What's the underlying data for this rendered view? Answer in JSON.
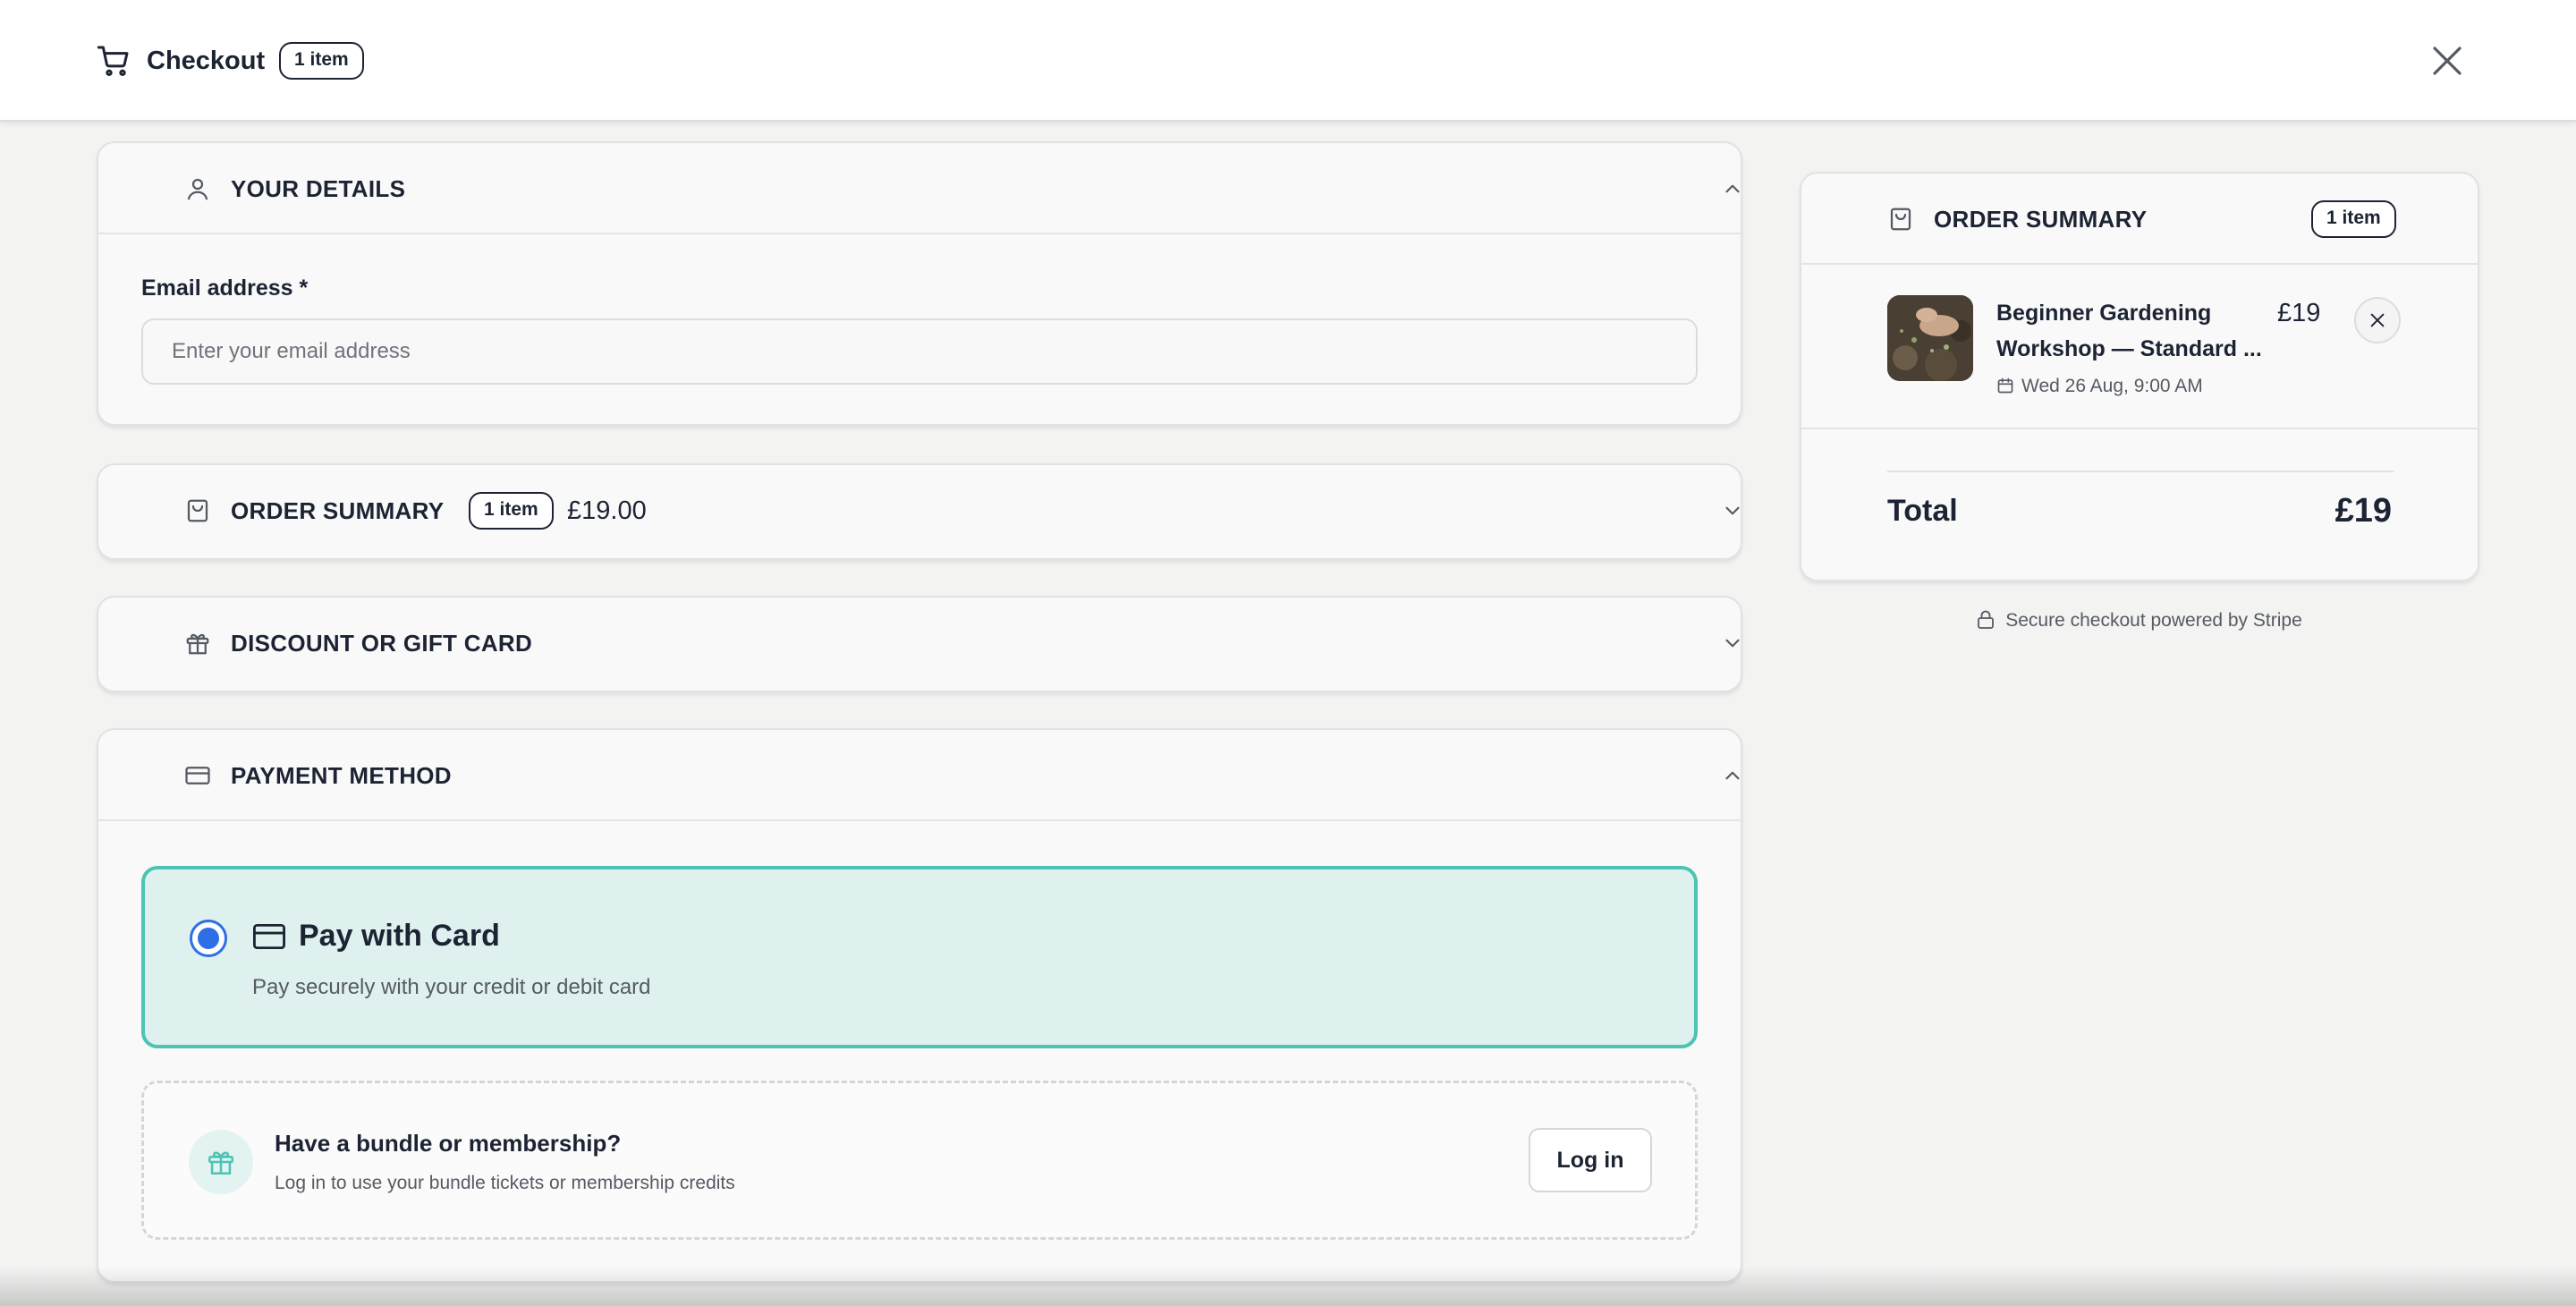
{
  "header": {
    "title": "Checkout",
    "item_count": "1 item"
  },
  "details": {
    "title": "YOUR DETAILS",
    "email_label": "Email address *",
    "email_placeholder": "Enter your email address",
    "email_value": ""
  },
  "summary_section": {
    "title": "ORDER SUMMARY",
    "item_count": "1 item",
    "price": "£19.00"
  },
  "discount": {
    "title": "DISCOUNT OR GIFT CARD"
  },
  "payment": {
    "title": "PAYMENT METHOD",
    "option_title": "Pay with Card",
    "option_sub": "Pay securely with your credit or debit card",
    "bundle_title": "Have a bundle or membership?",
    "bundle_sub": "Log in to use your bundle tickets or membership credits",
    "login_label": "Log in"
  },
  "order_summary": {
    "title": "ORDER SUMMARY",
    "item_count": "1 item",
    "item": {
      "name": "Beginner Gardening Workshop — Standard ...",
      "date": "Wed 26 Aug, 9:00 AM",
      "price": "£19"
    },
    "total_label": "Total",
    "total_value": "£19"
  },
  "secure_text": "Secure checkout powered by Stripe",
  "colors": {
    "accent_teal": "#4fc2b6",
    "selected_bg": "#dff1ef",
    "radio_blue": "#2f6fe6",
    "text_dark": "#1c2333"
  }
}
